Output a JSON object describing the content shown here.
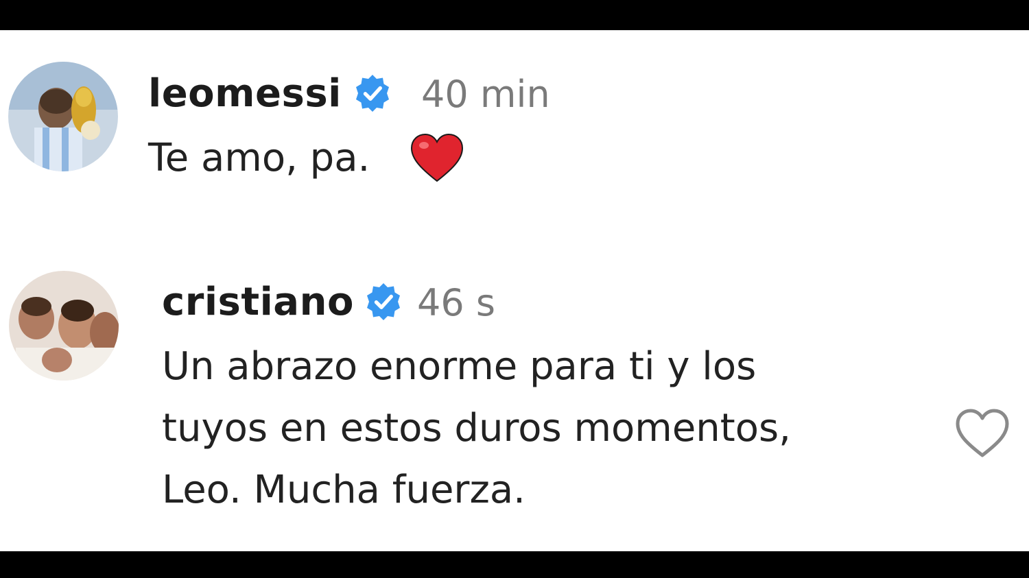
{
  "comments": [
    {
      "username": "leomessi",
      "verified": true,
      "time": "40 min",
      "text_lines": [
        "Te amo, pa."
      ],
      "emoji": "red-heart"
    },
    {
      "username": "cristiano",
      "verified": true,
      "time": "46 s",
      "text_lines": [
        "Un abrazo enorme para ti y los",
        "tuyos en estos duros momentos,",
        "Leo. Mucha fuerza."
      ]
    }
  ],
  "colors": {
    "verified_badge": "#3897f0",
    "emoji_heart": "#e0242e",
    "username": "#1c1c1c",
    "timestamp": "#7a7a7a"
  }
}
